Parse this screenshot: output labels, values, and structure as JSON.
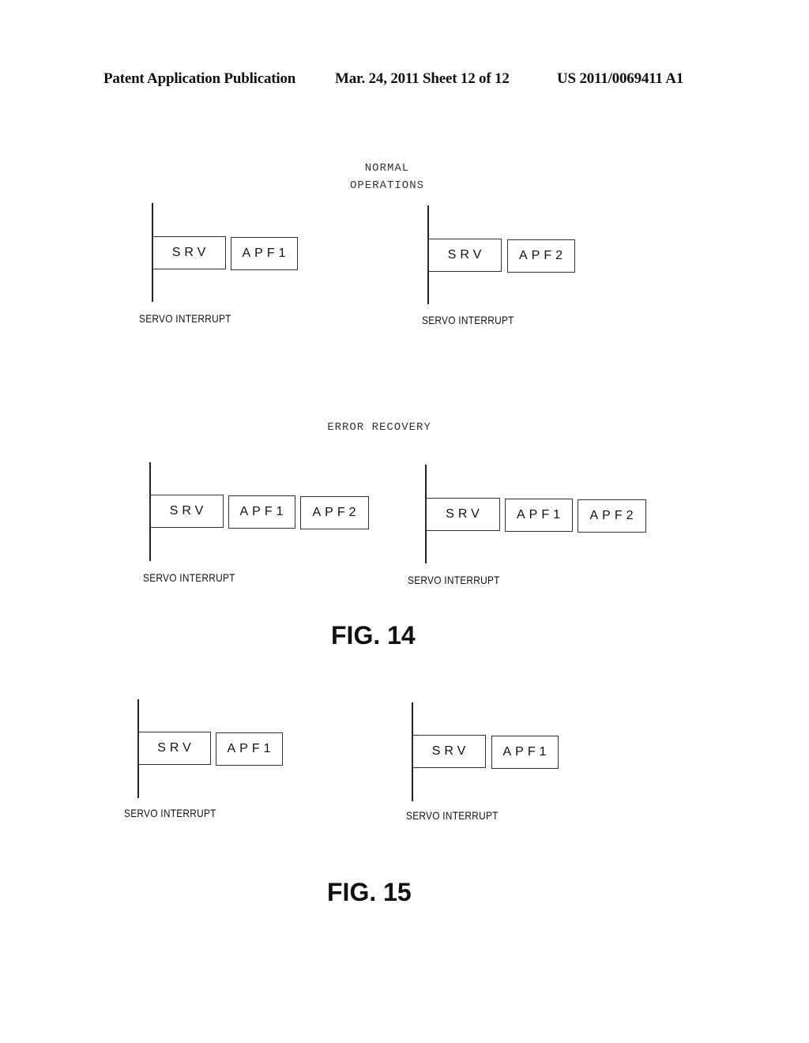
{
  "header": {
    "publication": "Patent Application Publication",
    "date_sheet": "Mar. 24, 2011  Sheet 12 of 12",
    "number": "US 2011/0069411 A1"
  },
  "fig14": {
    "label": "FIG. 14",
    "normal": {
      "title_line1": "NORMAL",
      "title_line2": "OPERATIONS",
      "timelines": [
        {
          "boxes": [
            "SRV",
            "APF1"
          ],
          "caption": "SERVO INTERRUPT"
        },
        {
          "boxes": [
            "SRV",
            "APF2"
          ],
          "caption": "SERVO INTERRUPT"
        }
      ]
    },
    "error": {
      "title": "ERROR RECOVERY",
      "timelines": [
        {
          "boxes": [
            "SRV",
            "APF1",
            "APF2"
          ],
          "caption": "SERVO INTERRUPT"
        },
        {
          "boxes": [
            "SRV",
            "APF1",
            "APF2"
          ],
          "caption": "SERVO INTERRUPT"
        }
      ]
    }
  },
  "fig15": {
    "label": "FIG. 15",
    "timelines": [
      {
        "boxes": [
          "SRV",
          "APF1"
        ],
        "caption": "SERVO INTERRUPT"
      },
      {
        "boxes": [
          "SRV",
          "APF1"
        ],
        "caption": "SERVO INTERRUPT"
      }
    ]
  }
}
